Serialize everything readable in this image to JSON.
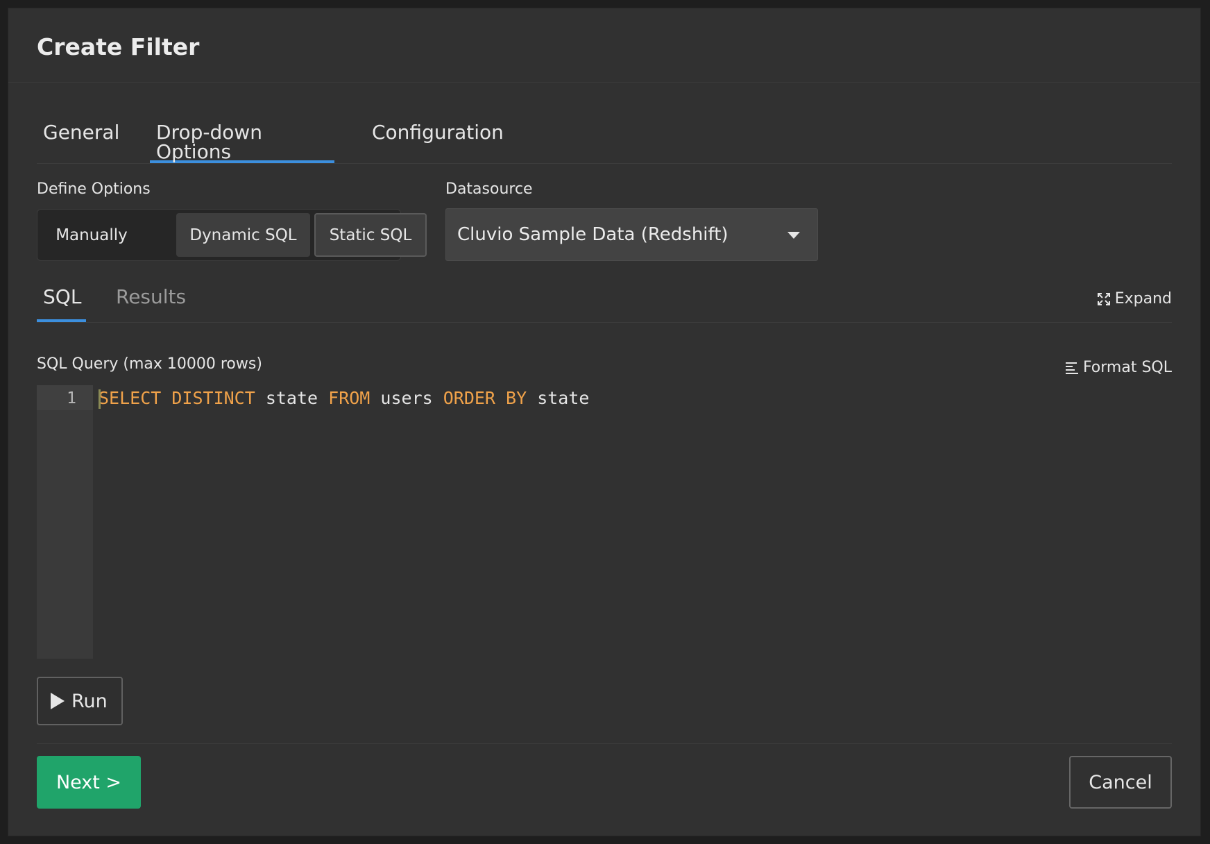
{
  "modal": {
    "title": "Create Filter"
  },
  "tabs": [
    {
      "label": "General"
    },
    {
      "label": "Drop-down Options"
    },
    {
      "label": "Configuration"
    }
  ],
  "define_options": {
    "label": "Define Options",
    "options": [
      "Manually",
      "Dynamic SQL",
      "Static SQL"
    ],
    "selected": "Static SQL"
  },
  "datasource": {
    "label": "Datasource",
    "value": "Cluvio Sample Data (Redshift)"
  },
  "sql_tabs": [
    {
      "label": "SQL"
    },
    {
      "label": "Results"
    }
  ],
  "expand_label": "Expand",
  "query": {
    "label": "SQL Query (max 10000 rows)",
    "format_label": "Format SQL",
    "line_number": "1",
    "tokens": [
      "SELECT DISTINCT",
      " state ",
      "FROM",
      " users ",
      "ORDER BY",
      " state"
    ]
  },
  "run_label": "Run",
  "footer": {
    "next_label": "Next >",
    "cancel_label": "Cancel"
  },
  "colors": {
    "accent": "#3c8fde",
    "primary_button": "#20a46a",
    "keyword": "#f0a24a"
  }
}
